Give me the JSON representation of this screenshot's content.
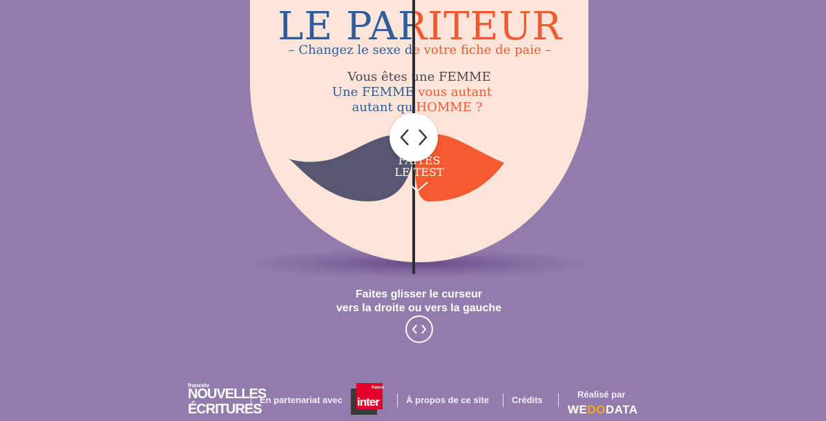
{
  "header": {
    "title_left": "LE PAR",
    "title_right": "ITEUR",
    "title_full": "LE PARITEUR",
    "subtitle": "– Changez le sexe de votre fiche de paie –"
  },
  "question": {
    "line1": "Vous êtes une FEMME",
    "line2": "Une FEMME vous autant",
    "line3": "autant qu'HOMME ?"
  },
  "cta": {
    "line1": "FAITES",
    "line2": "LE TEST"
  },
  "instructions": {
    "line1": "Faites glisser le curseur",
    "line2": "vers la droite ou vers la gauche"
  },
  "footer": {
    "partner_label": "En partenariat avec",
    "about_link": "À propos de ce site",
    "credits_link": "Crédits",
    "made_by_label": "Réalisé par",
    "francetv_small": "francetv",
    "nouvelles_line1": "NOUVELLES",
    "nouvelles_line2": "ÉCRITURES",
    "inter_word": "inter",
    "inter_small": "france",
    "wedodata_part1": "WE",
    "wedodata_part2": "DO",
    "wedodata_part3": "DATA"
  },
  "colors": {
    "background": "#917cab",
    "face": "#fde4d8",
    "blue": "#2d5d9a",
    "orange": "#f05a30",
    "mustache": "#565670",
    "divider": "#2c2c34"
  },
  "icons": {
    "slider_handle": "chevrons-left-right-icon",
    "check": "check-icon"
  }
}
